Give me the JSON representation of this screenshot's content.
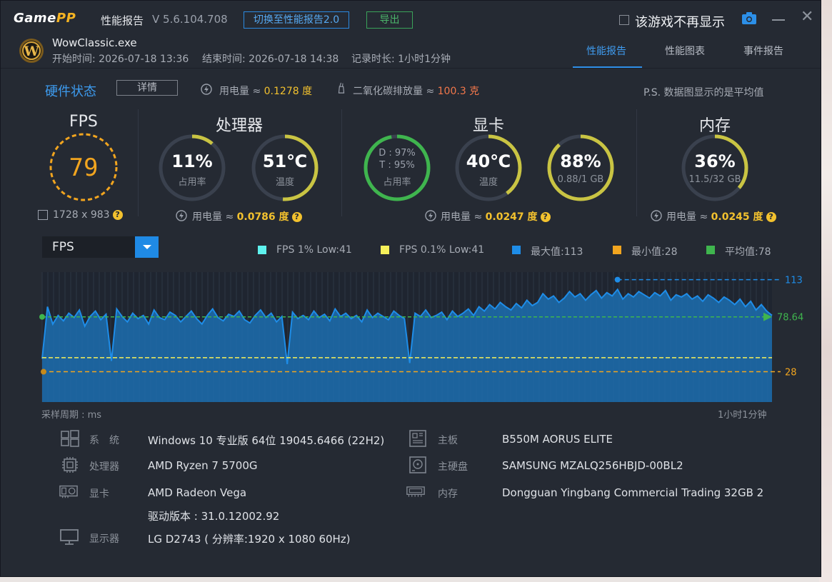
{
  "app": {
    "logo": {
      "a": "Game",
      "b": "PP"
    },
    "title": "性能报告",
    "version": "V 5.6.104.708",
    "switch_btn": "切换至性能报告2.0",
    "export_btn": "导出",
    "hide_label": "该游戏不再显示"
  },
  "game": {
    "exe": "WowClassic.exe",
    "start": "开始时间: 2026-07-18 13:36",
    "end": "结束时间: 2026-07-18 14:38",
    "duration": "记录时长: 1小时1分钟"
  },
  "tabs": [
    "性能报告",
    "性能图表",
    "事件报告"
  ],
  "status": {
    "title": "硬件状态",
    "detail_btn": "详情",
    "power_label": "用电量 ≈ ",
    "power_value": "0.1278 度",
    "co2_label": "二氧化碳排放量 ≈ ",
    "co2_value": "100.3 克",
    "note": "P.S. 数据图显示的是平均值"
  },
  "fps_panel": {
    "title": "FPS",
    "value": "79",
    "resolution": "1728 x 983"
  },
  "cpu_panel": {
    "title": "处理器",
    "usage": {
      "value": "11%",
      "label": "占用率",
      "fraction": 0.11
    },
    "temp": {
      "value": "51℃",
      "label": "温度",
      "fraction": 0.51
    },
    "power_label": "用电量 ≈ ",
    "power_value": "0.0786 度"
  },
  "gpu_panel": {
    "title": "显卡",
    "usage": {
      "line1": "D : 97%",
      "line2": "T : 95%",
      "label": "占用率",
      "fraction": 0.97
    },
    "temp": {
      "value": "40℃",
      "label": "温度",
      "fraction": 0.4
    },
    "vram": {
      "value": "88%",
      "label": "0.88/1 GB",
      "fraction": 0.88
    },
    "power_label": "用电量 ≈ ",
    "power_value": "0.0247 度"
  },
  "mem_panel": {
    "title": "内存",
    "usage": {
      "value": "36%",
      "label": "11.5/32 GB",
      "fraction": 0.36
    },
    "power_label": "用电量 ≈ ",
    "power_value": "0.0245 度"
  },
  "chart": {
    "selector": "FPS",
    "legend": [
      {
        "label": "FPS 1% Low:41",
        "color": "#5ef2ee"
      },
      {
        "label": "FPS 0.1% Low:41",
        "color": "#f5f05a"
      },
      {
        "label": "最大值:113",
        "color": "#1e8de8"
      },
      {
        "label": "最小值:28",
        "color": "#f2a51f"
      },
      {
        "label": "平均值:78",
        "color": "#3fb54e"
      }
    ],
    "max_label": "113",
    "avg_label": "78.64",
    "min_label": "28",
    "caption_left": "采样周期 : ms",
    "caption_right": "1小时1分钟"
  },
  "chart_data": {
    "type": "area",
    "title": "",
    "xlabel": "采样周期 : ms",
    "ylabel": "",
    "ylim": [
      0,
      120
    ],
    "reference_lines": [
      {
        "name": "最大值",
        "value": 113
      },
      {
        "name": "平均值",
        "value": 78.64
      },
      {
        "name": "最小值",
        "value": 28
      },
      {
        "name": "FPS 1% Low",
        "value": 41
      },
      {
        "name": "FPS 0.1% Low",
        "value": 41
      }
    ],
    "series": [
      {
        "name": "FPS",
        "values": [
          40,
          88,
          72,
          80,
          75,
          82,
          78,
          85,
          70,
          79,
          84,
          76,
          81,
          38,
          86,
          79,
          74,
          82,
          77,
          80,
          72,
          85,
          78,
          76,
          83,
          80,
          74,
          79,
          84,
          77,
          72,
          80,
          86,
          78,
          75,
          81,
          79,
          84,
          76,
          73,
          80,
          85,
          78,
          82,
          74,
          79,
          35,
          83,
          77,
          80,
          76,
          84,
          78,
          81,
          75,
          86,
          79,
          82,
          77,
          80,
          74,
          85,
          78,
          82,
          79,
          76,
          84,
          80,
          77,
          36,
          82,
          79,
          85,
          78,
          80,
          83,
          76,
          84,
          79,
          82,
          86,
          80,
          88,
          84,
          90,
          86,
          92,
          88,
          85,
          91,
          87,
          94,
          89,
          92,
          100,
          95,
          98,
          92,
          96,
          102,
          97,
          100,
          94,
          99,
          103,
          96,
          101,
          98,
          104,
          95,
          100,
          97,
          102,
          99,
          96,
          101,
          98,
          103,
          94,
          99,
          97,
          100,
          95,
          98,
          93,
          99,
          96,
          92,
          97,
          94,
          90,
          95,
          88,
          93,
          85,
          90,
          84,
          80
        ]
      }
    ]
  },
  "sysinfo": {
    "os": {
      "label": "系　统",
      "value": "Windows 10 专业版 64位 19045.6466 (22H2)"
    },
    "cpu": {
      "label": "处理器",
      "value": "AMD Ryzen 7 5700G"
    },
    "gpu": {
      "label": "显卡",
      "value": "AMD Radeon Vega",
      "driver": "驱动版本 : 31.0.12002.92"
    },
    "monitor": {
      "label": "显示器",
      "value": "LG D2743 ( 分辨率:1920 x 1080 60Hz)"
    },
    "board": {
      "label": "主板",
      "value": "B550M AORUS ELITE"
    },
    "disk": {
      "label": "主硬盘",
      "value": "SAMSUNG MZALQ256HBJD-00BL2"
    },
    "mem": {
      "label": "内存",
      "value": "Dongguan Yingbang Commercial Trading 32GB 2"
    }
  },
  "colors": {
    "accent_blue": "#1e8de8",
    "gauge_yellow": "#c9c443",
    "gauge_green": "#3fb54e",
    "fps_orange": "#f2a51f",
    "power_yellow": "#f2c12e"
  }
}
